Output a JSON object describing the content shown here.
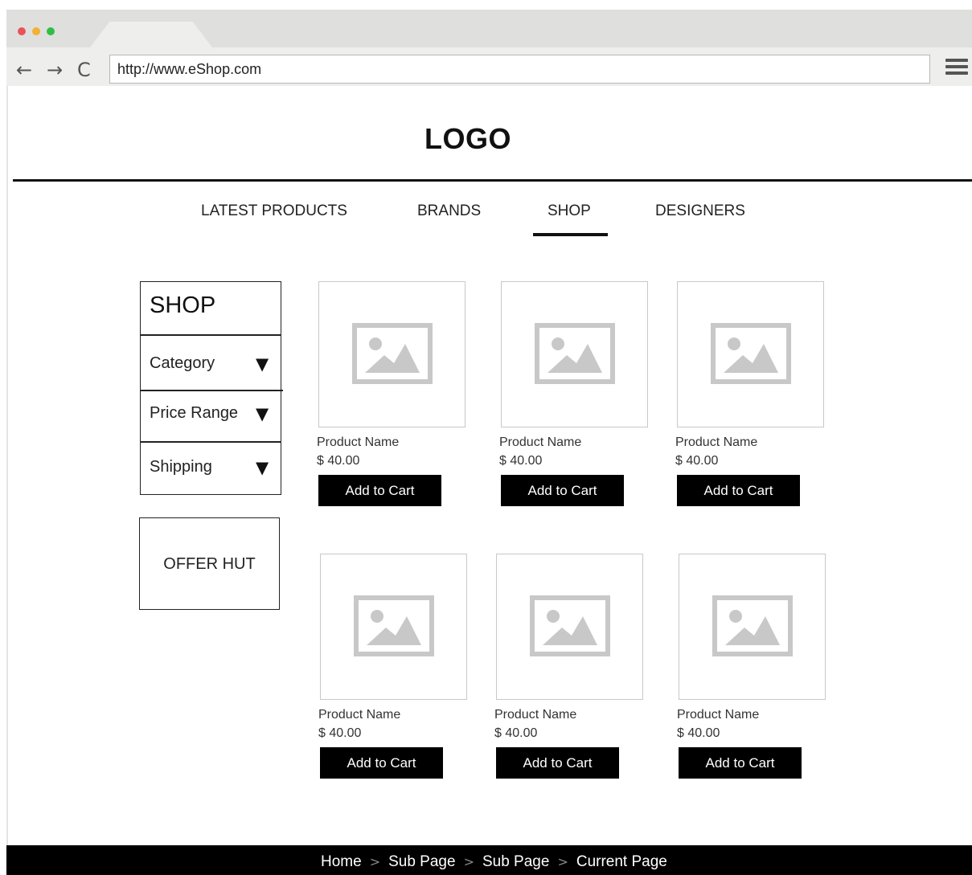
{
  "browser": {
    "url": "http://www.eShop.com",
    "back_icon": "arrow-left-icon",
    "forward_icon": "arrow-right-icon",
    "reload_icon": "reload-icon",
    "menu_icon": "hamburger-menu-icon",
    "dot_colors": [
      "#e8545a",
      "#f2b132",
      "#2fbf45"
    ]
  },
  "header": {
    "logo": "LOGO"
  },
  "nav": {
    "items": [
      {
        "label": "LATEST PRODUCTS"
      },
      {
        "label": "BRANDS"
      },
      {
        "label": "SHOP",
        "active": true
      },
      {
        "label": "DESIGNERS"
      }
    ]
  },
  "sidebar": {
    "title": "SHOP",
    "filters": [
      {
        "label": "Category",
        "arrow": "▼"
      },
      {
        "label": "Price Range",
        "arrow": "▼"
      },
      {
        "label": "Shipping",
        "arrow": "▼"
      }
    ],
    "offer": "OFFER HUT"
  },
  "products": [
    {
      "name": "Product Name",
      "price": "$ 40.00",
      "button": "Add to Cart"
    },
    {
      "name": "Product Name",
      "price": "$ 40.00",
      "button": "Add to Cart"
    },
    {
      "name": "Product Name",
      "price": "$ 40.00",
      "button": "Add to Cart"
    },
    {
      "name": "Product Name",
      "price": "$ 40.00",
      "button": "Add to Cart"
    },
    {
      "name": "Product Name",
      "price": "$ 40.00",
      "button": "Add to Cart"
    },
    {
      "name": "Product Name",
      "price": "$ 40.00",
      "button": "Add to Cart"
    }
  ],
  "footer": {
    "breadcrumb": [
      "Home",
      "Sub Page",
      "Sub Page",
      "Current Page"
    ],
    "separator": ">"
  },
  "colors": {
    "accent": "#000000",
    "placeholder": "#c8c8c8",
    "chrome": "#dfe0dd"
  }
}
